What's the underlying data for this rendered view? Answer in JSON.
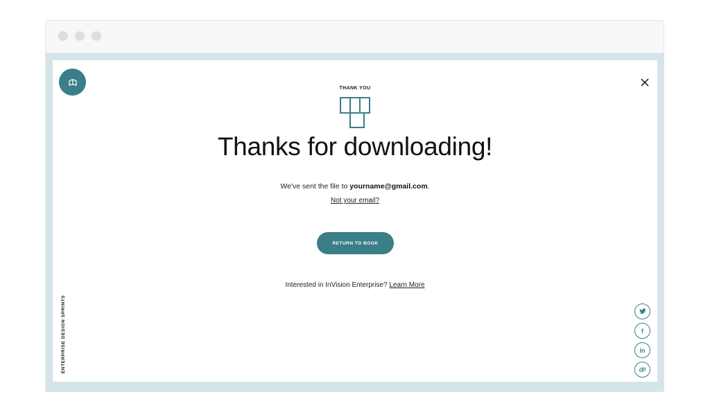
{
  "header": {
    "eyebrow": "THANK YOU"
  },
  "main": {
    "headline": "Thanks for downloading!",
    "sent_prefix": "We've sent the file to ",
    "email": "yourname@gmail.com",
    "sent_suffix": ".",
    "not_email_link": "Not your email?",
    "cta_label": "RETURN TO BOOK",
    "interest_text": "Interested in InVision Enterprise? ",
    "learn_more_link": "Learn More"
  },
  "sidebar": {
    "vertical_label": "ENTERPRISE DESIGN SPRINTS"
  },
  "social": {
    "items": [
      {
        "icon": "twitter-icon",
        "glyph": "🐦"
      },
      {
        "icon": "facebook-icon",
        "glyph": "f"
      },
      {
        "icon": "linkedin-icon",
        "glyph": "in"
      },
      {
        "icon": "link-icon",
        "glyph": "🔗"
      }
    ]
  },
  "colors": {
    "accent": "#3a7e87",
    "frame": "#d5e4e8"
  }
}
